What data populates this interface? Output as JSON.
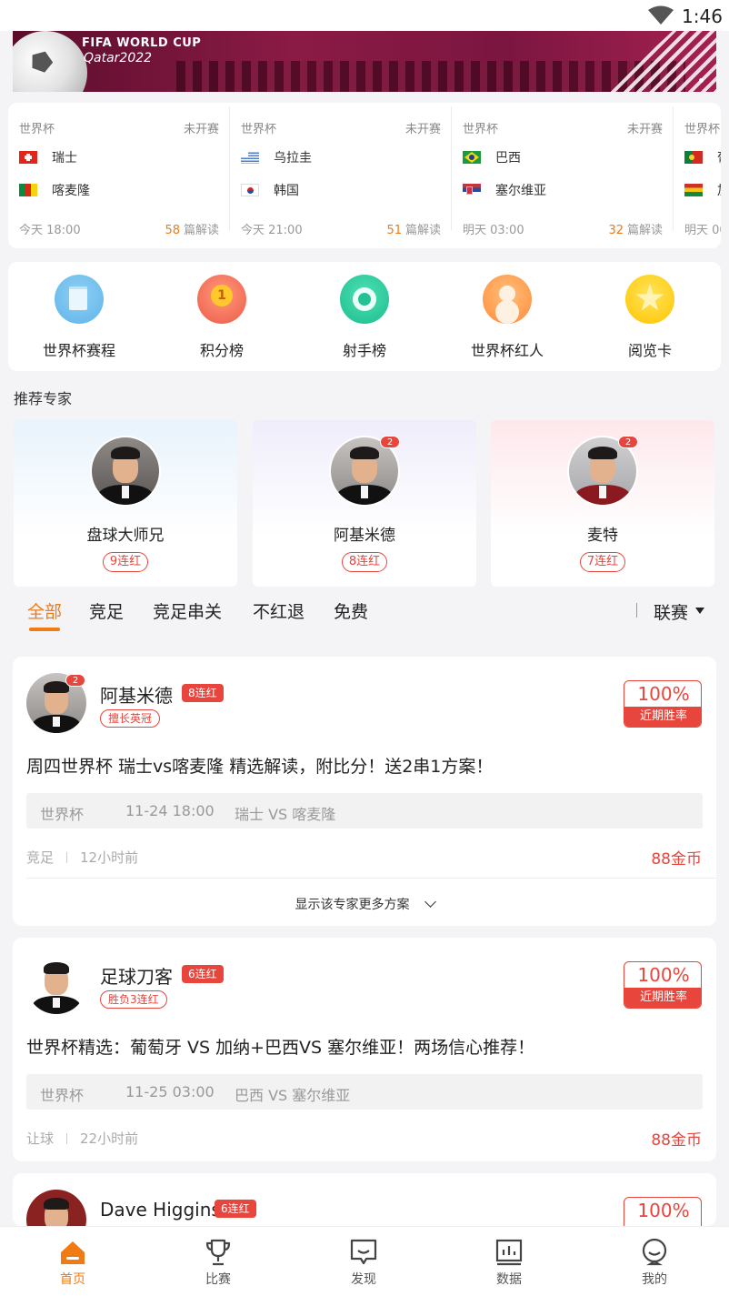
{
  "status_bar": {
    "time": "1:46"
  },
  "banner": {
    "title": "FIFA WORLD CUP",
    "subtitle": "Qatar2022"
  },
  "matches": [
    {
      "league": "世界杯",
      "state": "未开赛",
      "home": "瑞士",
      "away": "喀麦隆",
      "time": "今天 18:00",
      "reads": "58",
      "reads_label": "篇解读"
    },
    {
      "league": "世界杯",
      "state": "未开赛",
      "home": "乌拉圭",
      "away": "韩国",
      "time": "今天 21:00",
      "reads": "51",
      "reads_label": "篇解读"
    },
    {
      "league": "世界杯",
      "state": "未开赛",
      "home": "巴西",
      "away": "塞尔维亚",
      "time": "明天 03:00",
      "reads": "32",
      "reads_label": "篇解读"
    },
    {
      "league": "世界杯",
      "home": "葡",
      "away": "加",
      "time": "明天 00"
    }
  ],
  "quick_menu": [
    {
      "label": "世界杯赛程",
      "icon": "schedule-icon"
    },
    {
      "label": "积分榜",
      "icon": "trophy-medal-icon"
    },
    {
      "label": "射手榜",
      "icon": "soccer-ball-icon"
    },
    {
      "label": "世界杯红人",
      "icon": "person-icon"
    },
    {
      "label": "阅览卡",
      "icon": "star-icon"
    }
  ],
  "experts_section": {
    "title": "推荐专家",
    "items": [
      {
        "name": "盘球大师兄",
        "streak": "9连红"
      },
      {
        "name": "阿基米德",
        "streak": "8连红",
        "count": "2"
      },
      {
        "name": "麦特",
        "streak": "7连红",
        "count": "2"
      }
    ]
  },
  "tabs": {
    "items": [
      "全部",
      "竞足",
      "竞足串关",
      "不红退",
      "免费"
    ],
    "active": "全部",
    "league_filter": "联赛"
  },
  "cards": [
    {
      "name": "阿基米德",
      "count": "2",
      "streak": "8连红",
      "tag": "擅长英冠",
      "rate": "100%",
      "rate_label": "近期胜率",
      "title": "周四世界杯  瑞士vs喀麦隆  精选解读，附比分！送2串1方案！",
      "league": "世界杯",
      "datetime": "11-24 18:00",
      "match": "瑞士  VS  喀麦隆",
      "type": "竞足",
      "ago": "12小时前",
      "price": "88金币",
      "more": "显示该专家更多方案"
    },
    {
      "name": "足球刀客",
      "streak": "6连红",
      "tag": "胜负3连红",
      "rate": "100%",
      "rate_label": "近期胜率",
      "title": "世界杯精选：葡萄牙 VS 加纳+巴西VS 塞尔维亚！两场信心推荐！",
      "league": "世界杯",
      "datetime": "11-25 03:00",
      "match": "巴西  VS  塞尔维亚",
      "type": "让球",
      "ago": "22小时前",
      "price": "88金币"
    },
    {
      "name": "Dave Higgins",
      "streak": "6连红",
      "rate": "100%"
    }
  ],
  "bottom_nav": [
    {
      "label": "首页",
      "icon": "home-icon",
      "active": true
    },
    {
      "label": "比赛",
      "icon": "trophy-icon"
    },
    {
      "label": "发现",
      "icon": "discover-icon"
    },
    {
      "label": "数据",
      "icon": "data-chart-icon"
    },
    {
      "label": "我的",
      "icon": "profile-icon"
    }
  ],
  "colors": {
    "accent": "#f07a14",
    "red": "#e8453c",
    "background": "#f4f4f6"
  }
}
